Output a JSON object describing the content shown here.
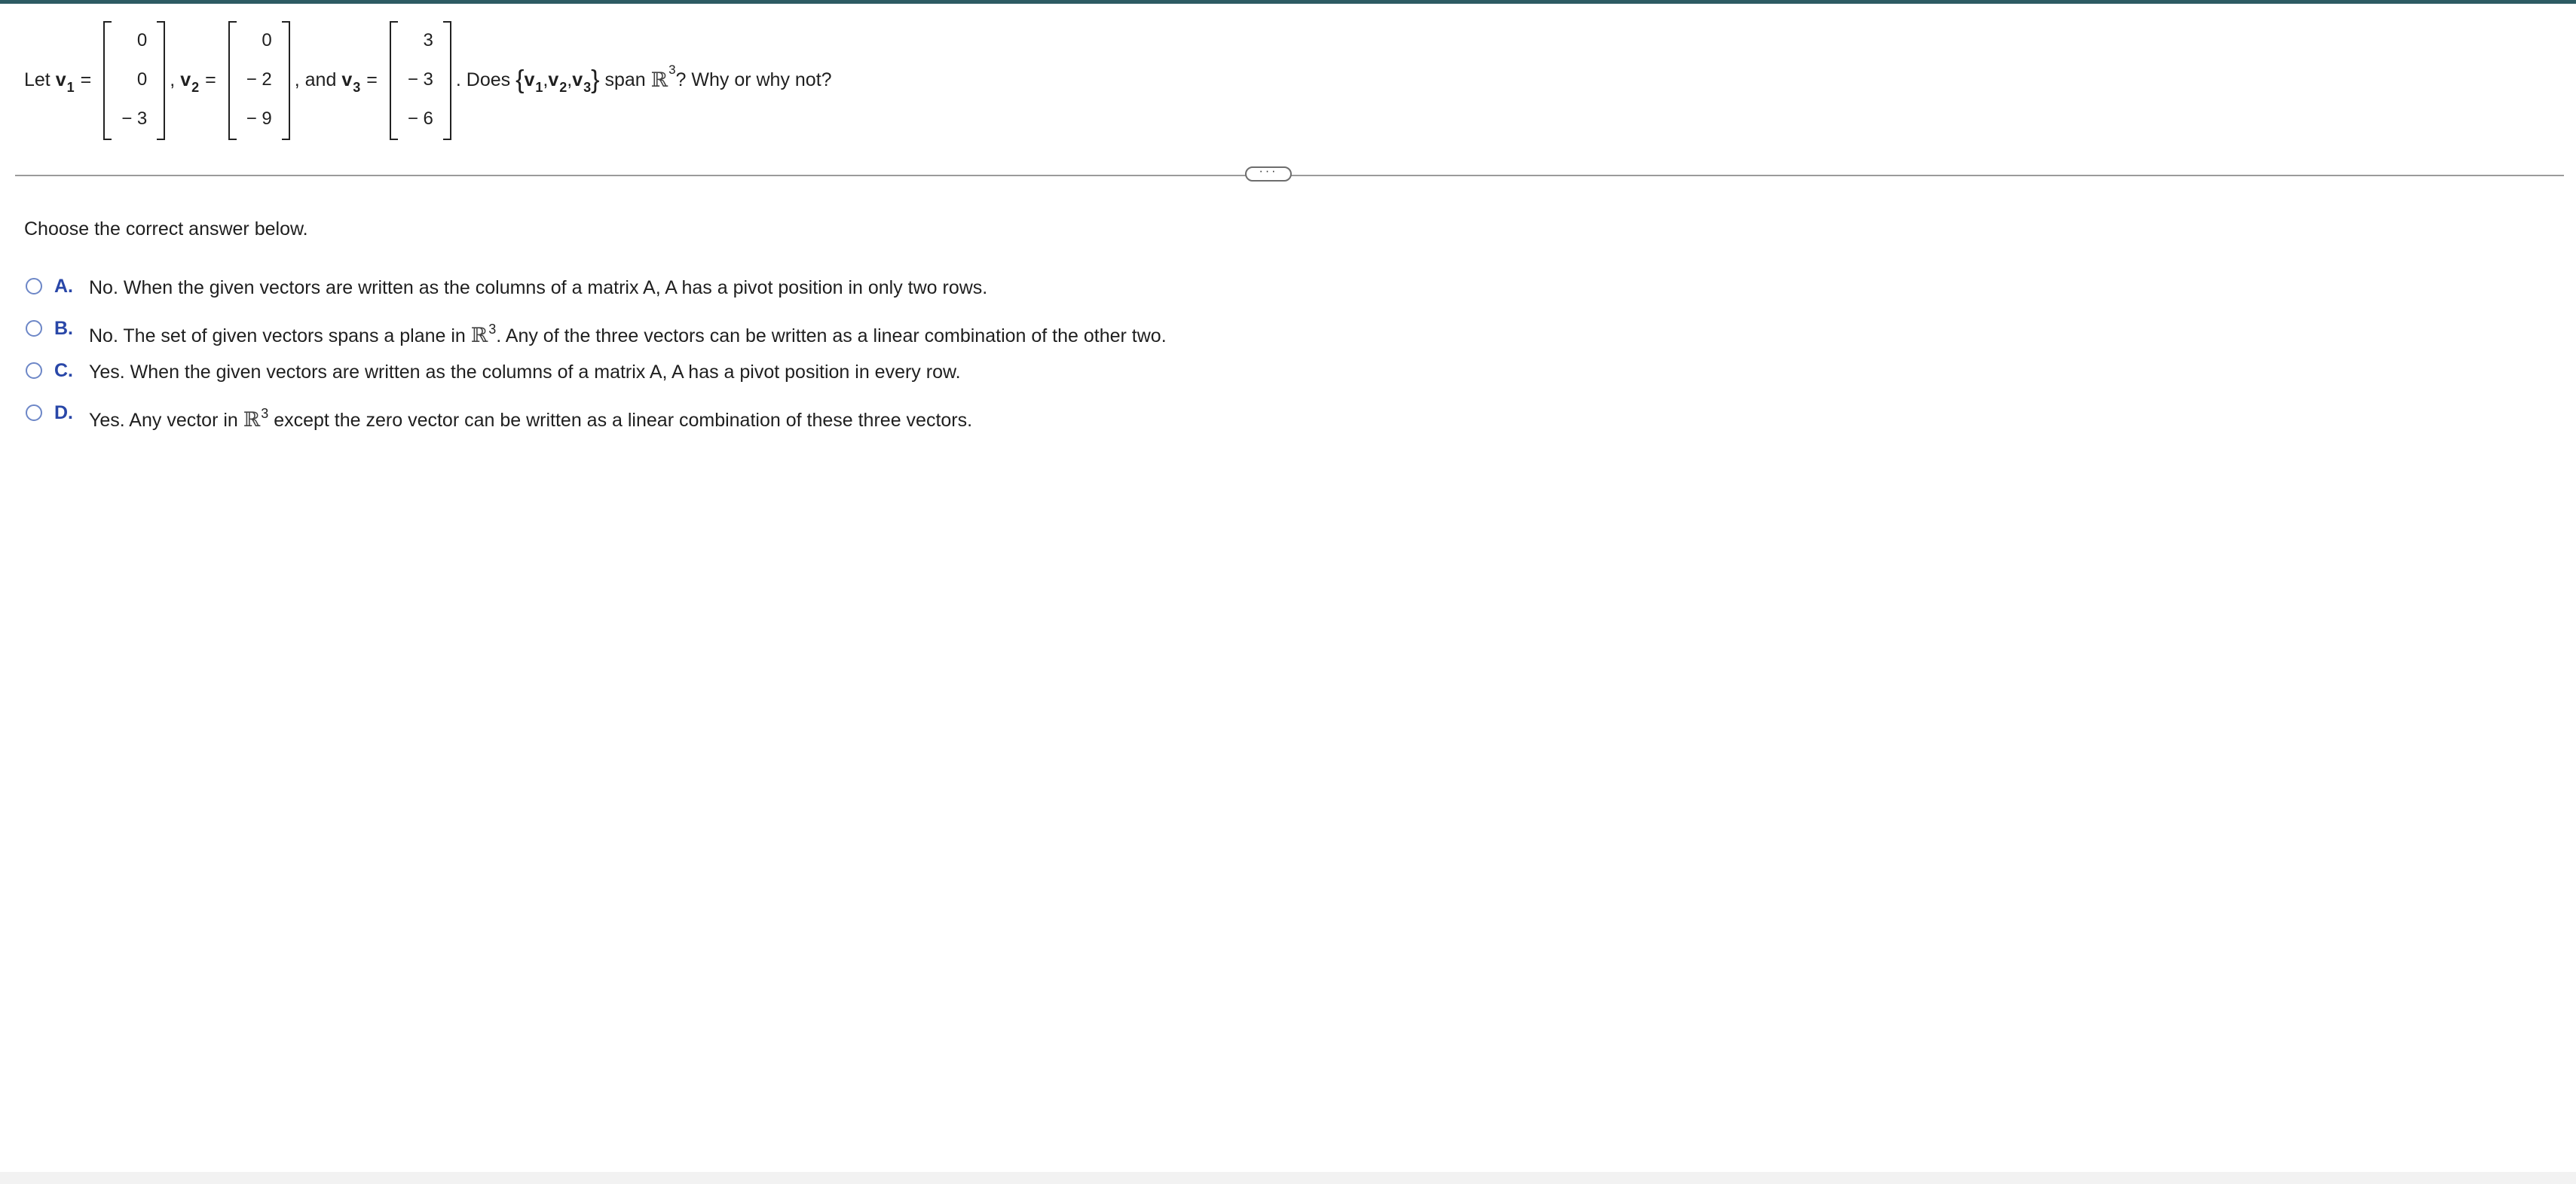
{
  "question": {
    "let": "Let",
    "v": "v",
    "sub1": "1",
    "sub2": "2",
    "sub3": "3",
    "equals": "=",
    "comma": ",",
    "and": ", and",
    "v1": [
      "0",
      "0",
      "− 3"
    ],
    "v2": [
      "0",
      "− 2",
      "− 9"
    ],
    "v3": [
      "3",
      "− 3",
      "− 6"
    ],
    "does": ". Does",
    "set_open": "{",
    "set_close": "}",
    "set_sep": ",",
    "span": "span",
    "R": "ℝ",
    "exp": "3",
    "tail": "? Why or why not?"
  },
  "divider": {
    "more_label": "···"
  },
  "instruction": "Choose the correct answer below.",
  "options": [
    {
      "letter": "A.",
      "text": "No. When the given vectors are written as the columns of a matrix A, A has a pivot position in only two rows."
    },
    {
      "letter": "B.",
      "pre": "No. The set of given vectors spans a plane in",
      "R": "ℝ",
      "exp": "3",
      "post": ". Any of the three vectors can be written as a linear combination of the other two."
    },
    {
      "letter": "C.",
      "text": "Yes. When the given vectors are written as the columns of a matrix A, A has a pivot position in every row."
    },
    {
      "letter": "D.",
      "pre": "Yes. Any vector in",
      "R": "ℝ",
      "exp": "3",
      "post": "except the zero vector can be written as a linear combination of these three vectors."
    }
  ],
  "colors": {
    "top_bar": "#2d5b63",
    "option_letter": "#2947a8",
    "radio_border": "#6d87c7"
  }
}
